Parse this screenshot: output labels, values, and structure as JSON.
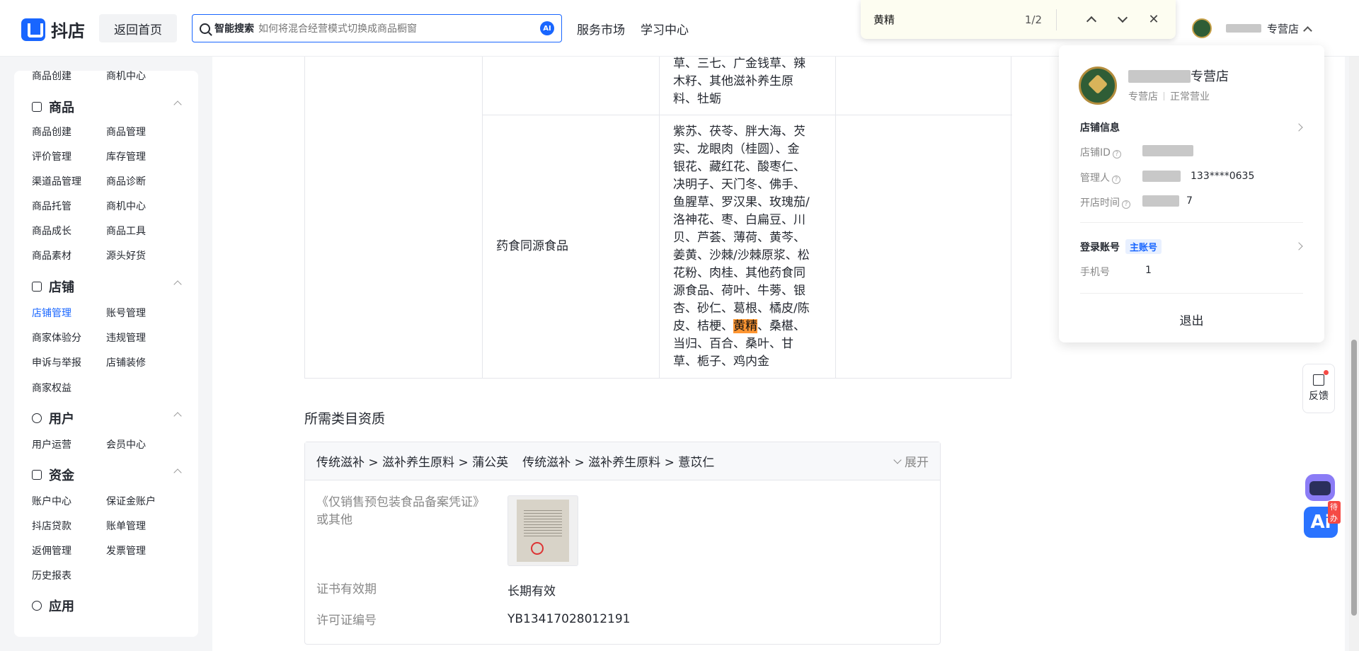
{
  "topbar": {
    "logo_text": "抖店",
    "home_button": "返回首页",
    "search_label": "智能搜索",
    "search_placeholder": "如何将混合经营模式切换成商品橱窗",
    "ai_badge": "AI",
    "nav": [
      "服务市场",
      "学习中心"
    ],
    "account_name": "专营店"
  },
  "findbar": {
    "query": "黄精",
    "count": "1/2"
  },
  "sidebar": {
    "top_items": [
      "商品创建",
      "商机中心"
    ],
    "sections": [
      {
        "title": "商品",
        "items": [
          "商品创建",
          "商品管理",
          "评价管理",
          "库存管理",
          "渠道品管理",
          "商品诊断",
          "商品托管",
          "商机中心",
          "商品成长",
          "商品工具",
          "商品素材",
          "源头好货"
        ]
      },
      {
        "title": "店铺",
        "items": [
          "店铺管理",
          "账号管理",
          "商家体验分",
          "违规管理",
          "申诉与举报",
          "店铺装修",
          "商家权益"
        ]
      },
      {
        "title": "用户",
        "items": [
          "用户运营",
          "会员中心"
        ]
      },
      {
        "title": "资金",
        "items": [
          "账户中心",
          "保证金账户",
          "抖店贷款",
          "账单管理",
          "返佣管理",
          "发票管理",
          "历史报表"
        ]
      },
      {
        "title": "应用",
        "items": []
      }
    ]
  },
  "table": {
    "row1_col3": [
      "草、三七、广金钱草、辣",
      "木籽、其他滋补养生原",
      "料、牡蛎"
    ],
    "row2_col2": "药食同源食品",
    "row2_col3_lines": [
      "紫苏、茯苓、胖大海、芡",
      "实、龙眼肉（桂圆）、金",
      "银花、藏红花、酸枣仁、",
      "决明子、天门冬、佛手、",
      "鱼腥草、罗汉果、玫瑰茄/",
      "洛神花、枣、白扁豆、川",
      "贝、芦荟、薄荷、黄芩、",
      "姜黄、沙棘/沙棘原浆、松",
      "花粉、肉桂、其他药食同",
      "源食品、荷叶、牛蒡、银",
      "杏、砂仁、葛根、橘皮/陈"
    ],
    "highlight_pre": "皮、桔梗、",
    "highlight_word": "黄精",
    "highlight_post": "、桑椹、",
    "row2_col3_tail": [
      "当归、百合、桑叶、甘",
      "草、栀子、鸡内金"
    ]
  },
  "qualification": {
    "section_title": "所需类目资质",
    "categories": [
      "传统滋补 > 滋补养生原料 > 蒲公英",
      "传统滋补 > 滋补养生原料 > 薏苡仁"
    ],
    "expand": "展开",
    "doc_label_line1": "《仅销售预包装食品备案凭证》",
    "doc_label_line2": "或其他",
    "validity_label": "证书有效期",
    "validity_value": "长期有效",
    "license_label": "许可证编号",
    "license_value": "YB13417028012191"
  },
  "popover": {
    "shop_name": "专营店",
    "shop_type": "专营店",
    "shop_status": "正常营业",
    "store_info": "店铺信息",
    "store_id_label": "店铺ID",
    "manager_label": "管理人",
    "manager_phone": "133****0635",
    "open_time_label": "开店时间",
    "open_time_suffix": "7",
    "login_account": "登录账号",
    "main_account_tag": "主账号",
    "phone_label": "手机号",
    "phone_value": "1",
    "logout": "退出"
  },
  "floating": {
    "feedback": "反馈",
    "todo": "待办",
    "ai": "Ai"
  }
}
